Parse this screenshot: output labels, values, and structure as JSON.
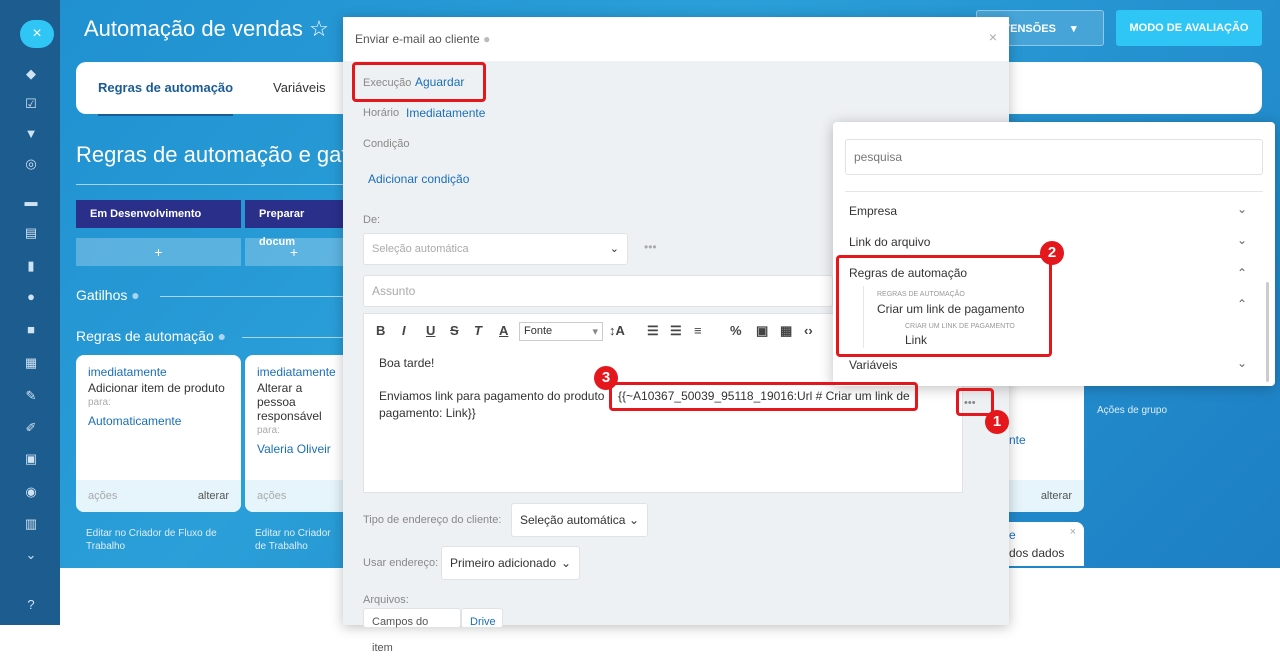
{
  "app": {
    "title": "Automação de vendas",
    "close": "×"
  },
  "top": {
    "extensions": "TENSÕES",
    "dropdown": "▾",
    "eval": "MODO DE AVALIAÇÃO"
  },
  "tabs": [
    "Regras de automação",
    "Variáveis"
  ],
  "section": {
    "title": "Regras de automação e gat"
  },
  "stages": [
    "Em Desenvolvimento",
    "Preparar docum"
  ],
  "labels": {
    "triggers": "Gatilhos",
    "rules": "Regras de automação",
    "group_actions": "Ações de grupo"
  },
  "cards": [
    {
      "c1": "imediatamente",
      "c2": "Adicionar item de produto",
      "c3": "para:",
      "c4": "Automaticamente",
      "foot": "ações",
      "alt": "alterar",
      "bottom": "Editar no Criador de Fluxo de Trabalho"
    },
    {
      "c1": "imediatamente",
      "c2": "Alterar a pessoa responsável",
      "c3": "para:",
      "c4": "Valeria Oliveira F",
      "foot": "ações",
      "alt": "",
      "bottom": "Editar no Criador de Trabalho"
    },
    {
      "c1": "",
      "c2": "",
      "c3": "",
      "c4": "nte",
      "foot": "",
      "alt": "alterar",
      "bottom": ""
    }
  ],
  "extra_card": {
    "text1": "e",
    "text2": "dos dados"
  },
  "modal": {
    "title": "Enviar e-mail ao cliente",
    "exec_label": "Execução",
    "exec_value": "Aguardar",
    "time_label": "Horário",
    "time_value": "Imediatamente",
    "cond_label": "Condição",
    "add_cond": "Adicionar condição",
    "from_label": "De:",
    "from_value": "Seleção automática",
    "subject_placeholder": "Assunto",
    "font": "Fonte",
    "greeting": "Boa tarde!",
    "body_line1": "Enviamos link para pagamento do produto",
    "token_line1": "{{~A10367_50039_95118_19016:Url # Criar um link de",
    "token_line2": "pagamento: Link}}",
    "addr_type_label": "Tipo de endereço do cliente:",
    "addr_type_value": "Seleção automática",
    "use_addr_label": "Usar endereço:",
    "use_addr_value": "Primeiro adicionado",
    "files_label": "Arquivos:",
    "files_tab1": "Campos do item",
    "files_tab2": "Drive"
  },
  "popup": {
    "search_placeholder": "pesquisa",
    "items": [
      "Empresa",
      "Link do arquivo",
      "Regras de automação",
      "Variáveis"
    ],
    "sub_caption": "REGRAS DE AUTOMAÇÃO",
    "sub_item": "Criar um link de pagamento",
    "subsub_caption": "CRIAR UM LINK DE PAGAMENTO",
    "subsub_item": "Link"
  },
  "badges": [
    "1",
    "2",
    "3"
  ],
  "colors": {
    "accent": "#2fc6f6",
    "link": "#1a6fb8",
    "annotation": "#e3171c",
    "stage": "#2a2f8a"
  }
}
